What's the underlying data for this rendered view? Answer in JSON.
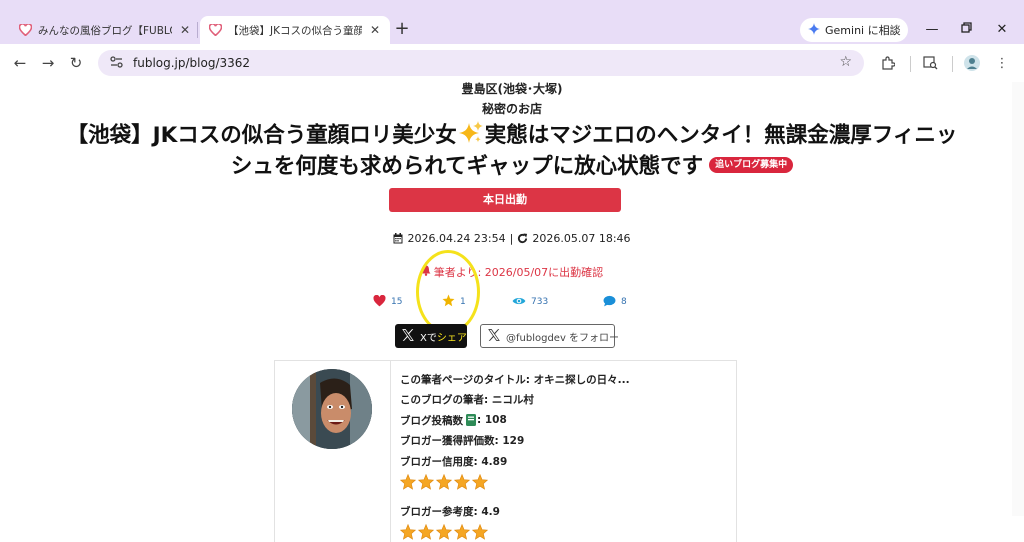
{
  "browser": {
    "tabs": [
      {
        "title": "みんなの風俗ブログ【FUBLOG】リア",
        "active": false
      },
      {
        "title": "【池袋】JKコスの似合う童顔ロリ美少",
        "active": true
      }
    ],
    "gemini_label": "Gemini に相談",
    "url": "fublog.jp/blog/3362"
  },
  "post": {
    "location": "豊島区(池袋･大塚)",
    "shop": "秘密のお店",
    "title_part1": "【池袋】JKコスの似合う童顔ロリ美少女",
    "title_part2": "実態はマジエロのヘンタイ！無課金濃厚フィニッ",
    "title_part3": "シュを何度も求められてギャップに放心状態です",
    "badge": "追いブログ募集中",
    "work_button": "本日出勤",
    "posted": "2026.04.24 23:54",
    "separator": "|",
    "updated": "2026.05.07 18:46",
    "notice": "筆者より: 2026/05/07に出勤確認",
    "stats": {
      "likes": "15",
      "stars": "1",
      "views": "733",
      "comments": "8"
    },
    "share_x": "X",
    "share_de": "で",
    "share_label": "シェア",
    "follow_label": "@fublogdev をフォロー"
  },
  "profile": {
    "page_title": "この筆者ページのタイトル: オキニ探しの日々...",
    "author": "このブログの筆者: ニコル村",
    "post_count_label": "ブログ投稿数",
    "post_count_value": ": 108",
    "ratings_received": "ブロガー獲得評価数: 129",
    "trust_label": "ブロガー信用度: 4.89",
    "trust_stars": 5,
    "reference_label": "ブロガー参考度: 4.9",
    "reference_stars": 5
  },
  "colors": {
    "accent_red": "#dc3545",
    "link_blue": "#3572b0",
    "heart": "#d9263d",
    "star": "#f0b400",
    "view": "#22a6d9",
    "comment": "#1a8fd8",
    "highlight": "#f5e21b"
  }
}
